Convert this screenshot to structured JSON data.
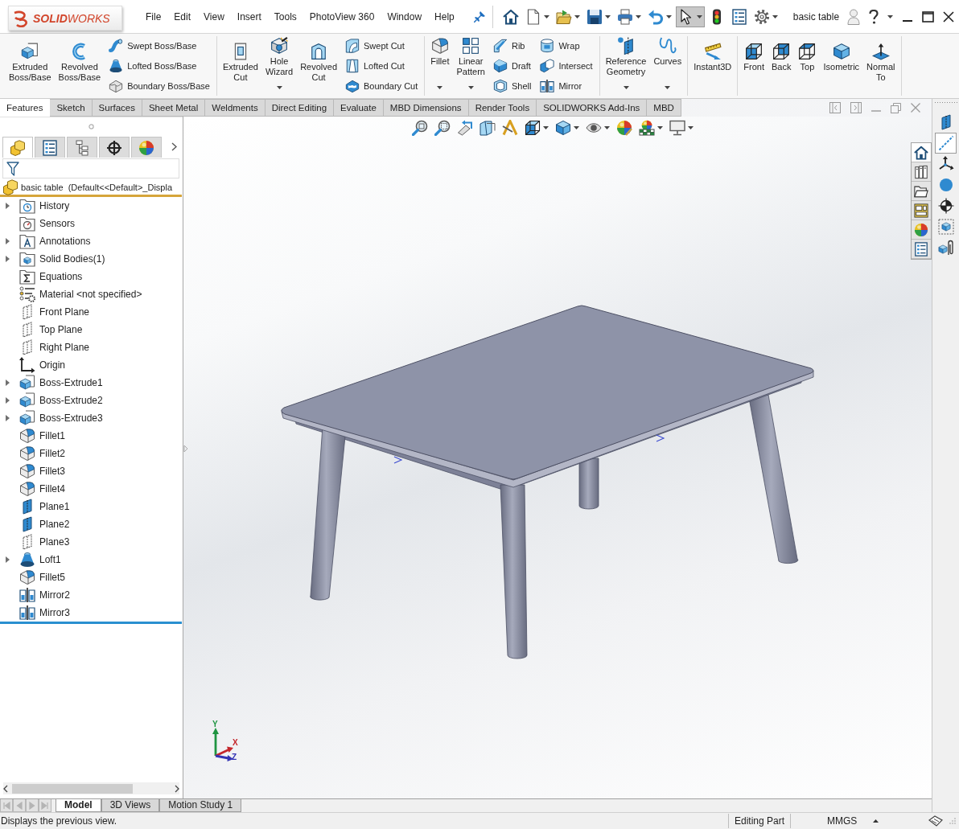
{
  "title_bar": {
    "logo": "**SOLID**WORKS",
    "menu": [
      "File",
      "Edit",
      "View",
      "Insert",
      "Tools",
      "PhotoView 360",
      "Window",
      "Help"
    ],
    "quick_access": [
      {
        "kind": "home",
        "dropdown": false,
        "selected": false
      },
      {
        "kind": "new",
        "dropdown": true,
        "selected": false
      },
      {
        "kind": "open",
        "dropdown": true,
        "selected": false
      },
      {
        "kind": "save",
        "dropdown": true,
        "selected": false
      },
      {
        "kind": "print",
        "dropdown": true,
        "selected": false
      },
      {
        "kind": "undo",
        "dropdown": true,
        "selected": false
      },
      {
        "kind": "select",
        "dropdown": true,
        "selected": true
      },
      {
        "kind": "rebuild",
        "dropdown": false,
        "selected": false
      },
      {
        "kind": "fileprops",
        "dropdown": false,
        "selected": false
      },
      {
        "kind": "options",
        "dropdown": true,
        "selected": false
      }
    ],
    "document_title": "basic table"
  },
  "ribbon": {
    "groups": [
      {
        "items": [
          {
            "kind": "extrude",
            "label": "Extruded Boss/Base",
            "dropdown": false
          },
          {
            "kind": "revolve",
            "label": "Revolved Boss/Base",
            "dropdown": false
          },
          {
            "kind": "stack",
            "items": [
              {
                "kind": "sweep",
                "label": "Swept Boss/Base"
              },
              {
                "kind": "loft",
                "label": "Lofted Boss/Base"
              },
              {
                "kind": "boundary",
                "label": "Boundary Boss/Base"
              }
            ]
          }
        ]
      },
      {
        "items": [
          {
            "kind": "extrudecut",
            "label": "Extruded Cut",
            "dropdown": false
          },
          {
            "kind": "hole",
            "label": "Hole Wizard",
            "dropdown": true
          },
          {
            "kind": "revolvecut",
            "label": "Revolved Cut",
            "dropdown": false
          },
          {
            "kind": "stack",
            "items": [
              {
                "kind": "sweepcut",
                "label": "Swept Cut"
              },
              {
                "kind": "loftcut",
                "label": "Lofted Cut"
              },
              {
                "kind": "boundarycut",
                "label": "Boundary Cut"
              }
            ]
          }
        ]
      },
      {
        "items": [
          {
            "kind": "fillet",
            "label": "Fillet",
            "dropdown": true
          },
          {
            "kind": "pattern",
            "label": "Linear Pattern",
            "dropdown": true
          },
          {
            "kind": "stack",
            "items": [
              {
                "kind": "rib",
                "label": "Rib"
              },
              {
                "kind": "draft",
                "label": "Draft"
              },
              {
                "kind": "shell",
                "label": "Shell"
              }
            ]
          },
          {
            "kind": "stack",
            "items": [
              {
                "kind": "wrap",
                "label": "Wrap"
              },
              {
                "kind": "intersect",
                "label": "Intersect"
              },
              {
                "kind": "mirror",
                "label": "Mirror"
              }
            ]
          }
        ]
      },
      {
        "items": [
          {
            "kind": "refgeom",
            "label": "Reference Geometry",
            "dropdown": true
          },
          {
            "kind": "curves",
            "label": "Curves",
            "dropdown": true
          }
        ]
      },
      {
        "items": [
          {
            "kind": "instant3d",
            "label": "Instant3D",
            "dropdown": false
          }
        ]
      },
      {
        "items": [
          {
            "kind": "front",
            "label": "Front",
            "dropdown": false
          },
          {
            "kind": "back",
            "label": "Back",
            "dropdown": false
          },
          {
            "kind": "top",
            "label": "Top",
            "dropdown": false
          },
          {
            "kind": "iso",
            "label": "Isometric",
            "dropdown": false
          },
          {
            "kind": "normal",
            "label": "Normal To",
            "dropdown": false
          }
        ]
      }
    ]
  },
  "command_tabs": [
    {
      "label": "Features",
      "selected": true
    },
    {
      "label": "Sketch",
      "selected": false
    },
    {
      "label": "Surfaces",
      "selected": false
    },
    {
      "label": "Sheet Metal",
      "selected": false
    },
    {
      "label": "Weldments",
      "selected": false
    },
    {
      "label": "Direct Editing",
      "selected": false
    },
    {
      "label": "Evaluate",
      "selected": false
    },
    {
      "label": "MBD Dimensions",
      "selected": false
    },
    {
      "label": "Render Tools",
      "selected": false
    },
    {
      "label": "SOLIDWORKS Add-Ins",
      "selected": false
    },
    {
      "label": "MBD",
      "selected": false
    }
  ],
  "feature_manager": {
    "tabs": [
      {
        "kind": "part",
        "selected": true
      },
      {
        "kind": "fileprops",
        "selected": false
      },
      {
        "kind": "config",
        "selected": false
      },
      {
        "kind": "dimxpert",
        "selected": false
      },
      {
        "kind": "display",
        "selected": false
      }
    ],
    "root": {
      "kind": "part",
      "label": "basic table  (Default<<Default>_Displa"
    },
    "items": [
      {
        "label": "History",
        "kind": "history",
        "expandable": true
      },
      {
        "label": "Sensors",
        "kind": "sensors",
        "expandable": false
      },
      {
        "label": "Annotations",
        "kind": "annotations",
        "expandable": true
      },
      {
        "label": "Solid Bodies(1)",
        "kind": "bodies",
        "expandable": true
      },
      {
        "label": "Equations",
        "kind": "equations",
        "expandable": false
      },
      {
        "label": "Material <not specified>",
        "kind": "material",
        "expandable": false
      },
      {
        "label": "Front Plane",
        "kind": "plane",
        "expandable": false
      },
      {
        "label": "Top Plane",
        "kind": "plane",
        "expandable": false
      },
      {
        "label": "Right Plane",
        "kind": "plane",
        "expandable": false
      },
      {
        "label": "Origin",
        "kind": "origin",
        "expandable": false
      },
      {
        "label": "Boss-Extrude1",
        "kind": "extrude",
        "expandable": true
      },
      {
        "label": "Boss-Extrude2",
        "kind": "extrude",
        "expandable": true
      },
      {
        "label": "Boss-Extrude3",
        "kind": "extrude",
        "expandable": true
      },
      {
        "label": "Fillet1",
        "kind": "fillet",
        "expandable": false
      },
      {
        "label": "Fillet2",
        "kind": "fillet",
        "expandable": false
      },
      {
        "label": "Fillet3",
        "kind": "fillet",
        "expandable": false
      },
      {
        "label": "Fillet4",
        "kind": "fillet",
        "expandable": false
      },
      {
        "label": "Plane1",
        "kind": "refplane",
        "expandable": false
      },
      {
        "label": "Plane2",
        "kind": "refplane",
        "expandable": false
      },
      {
        "label": "Plane3",
        "kind": "plane",
        "expandable": false
      },
      {
        "label": "Loft1",
        "kind": "loft",
        "expandable": true
      },
      {
        "label": "Fillet5",
        "kind": "fillet",
        "expandable": false
      },
      {
        "label": "Mirror2",
        "kind": "mirror",
        "expandable": false
      },
      {
        "label": "Mirror3",
        "kind": "mirror",
        "expandable": false
      }
    ]
  },
  "viewport": {
    "heads_up": [
      {
        "kind": "zoomfit",
        "dropdown": false
      },
      {
        "kind": "zoomarea",
        "dropdown": false
      },
      {
        "kind": "prevview",
        "dropdown": false
      },
      {
        "kind": "section",
        "dropdown": false
      },
      {
        "kind": "annotation",
        "dropdown": false
      },
      {
        "kind": "vieworient",
        "dropdown": true
      },
      {
        "kind": "iso",
        "dropdown": true
      },
      {
        "kind": "hideshow",
        "dropdown": true
      },
      {
        "kind": "appearance",
        "dropdown": false
      },
      {
        "kind": "scene",
        "dropdown": true
      },
      {
        "kind": "viewsettings",
        "dropdown": true
      }
    ],
    "task_pane": [
      {
        "kind": "home",
        "selected": true
      },
      {
        "kind": "library",
        "selected": false
      },
      {
        "kind": "explorer",
        "selected": false
      },
      {
        "kind": "palette",
        "selected": false
      },
      {
        "kind": "display",
        "selected": false
      },
      {
        "kind": "fileprops",
        "selected": false
      }
    ],
    "triad": [
      {
        "label": "Y",
        "color": "#1e9440"
      },
      {
        "label": "X",
        "color": "#c4262b"
      },
      {
        "label": "Z",
        "color": "#3434b4"
      }
    ]
  },
  "reference_toolbar": [
    {
      "kind": "refplane",
      "selected": false
    },
    {
      "kind": "axis",
      "selected": true
    },
    {
      "kind": "coord",
      "selected": false
    },
    {
      "kind": "point",
      "selected": false
    },
    {
      "kind": "com",
      "selected": false
    },
    {
      "kind": "bbox",
      "selected": false
    },
    {
      "kind": "materef",
      "selected": false
    }
  ],
  "bottom_bar": {
    "nav": [
      {
        "kind": "first",
        "disabled": true
      },
      {
        "kind": "prev",
        "disabled": true
      },
      {
        "kind": "next",
        "disabled": true
      },
      {
        "kind": "last",
        "disabled": true
      }
    ],
    "tabs": [
      {
        "label": "Model",
        "selected": true
      },
      {
        "label": "3D Views",
        "selected": false
      },
      {
        "label": "Motion Study 1",
        "selected": false
      }
    ]
  },
  "status_bar": {
    "message": "Displays the previous view.",
    "mode": "Editing Part",
    "units": "MMGS"
  }
}
